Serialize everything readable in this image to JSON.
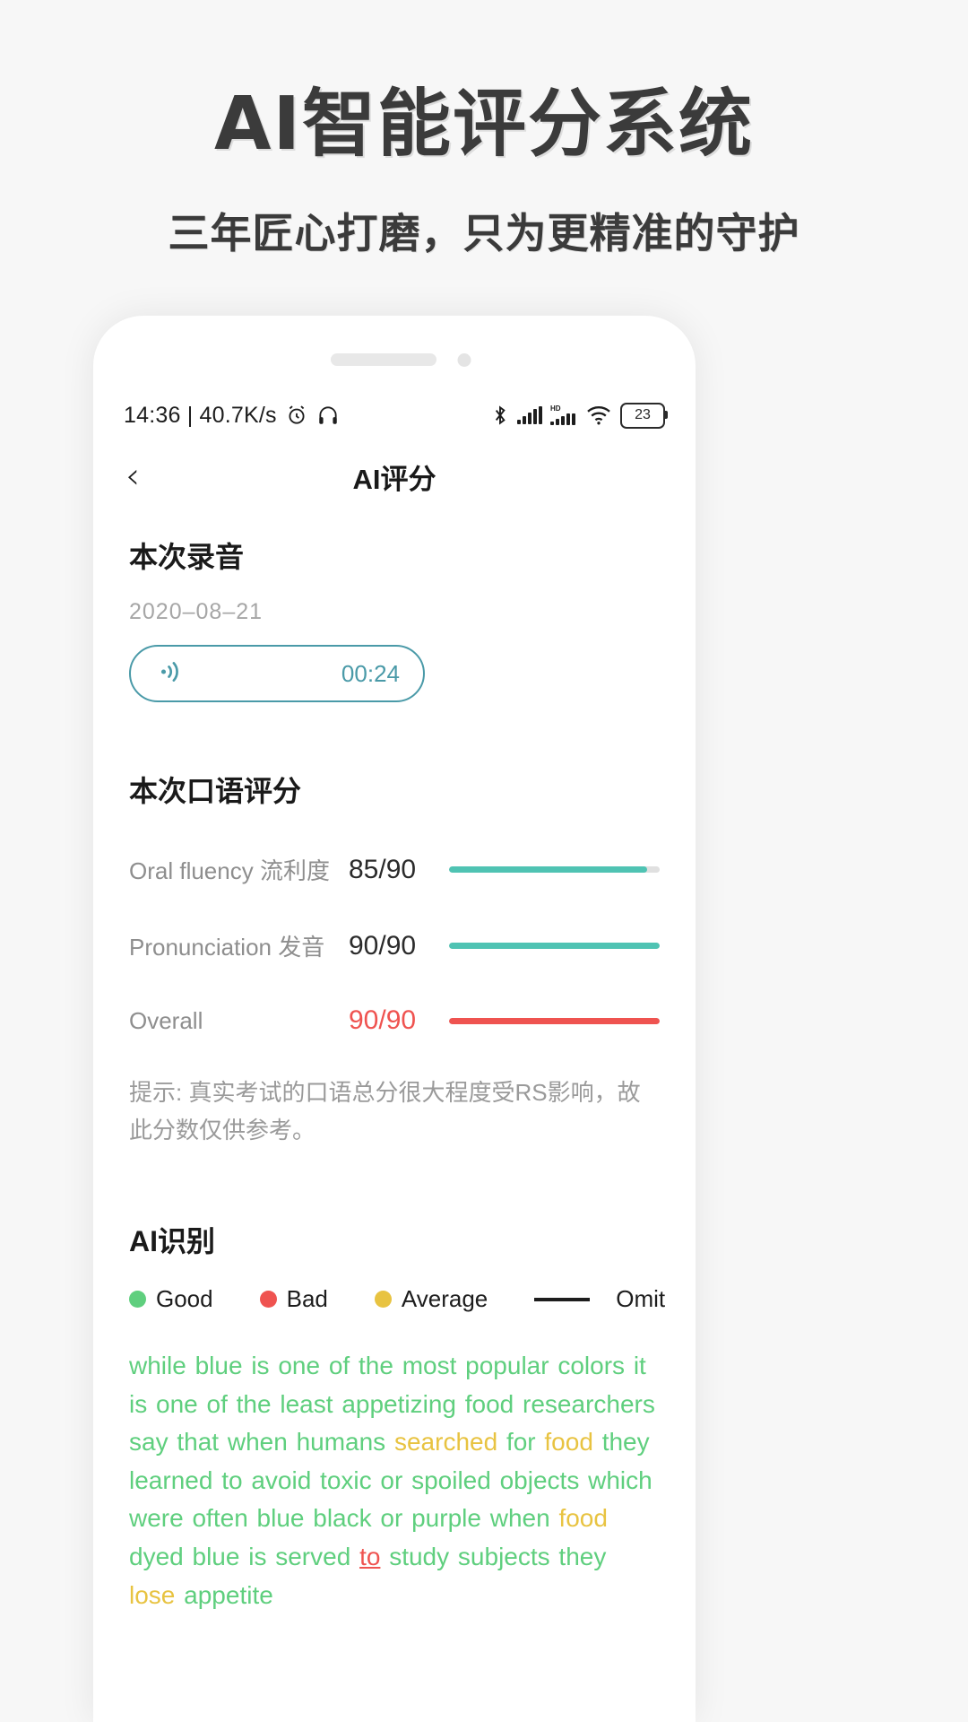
{
  "promo": {
    "title": "AI智能评分系统",
    "subtitle": "三年匠心打磨，只为更精准的守护"
  },
  "statusbar": {
    "time_and_speed": "14:36 | 40.7K/s",
    "alarm_icon": "alarm-clock-icon",
    "headphone_icon": "headphone-icon",
    "bluetooth_icon": "bluetooth-icon",
    "signal_icon": "signal-bars-icon",
    "hd_signal_icon": "hd-signal-bars-icon",
    "wifi_icon": "wifi-icon",
    "battery_level": "23"
  },
  "nav": {
    "back": "‹",
    "title": "AI评分"
  },
  "recording": {
    "section_title": "本次录音",
    "date": "2020–08–21",
    "play_icon": "audio-wave-icon",
    "duration": "00:24"
  },
  "scoring": {
    "section_title": "本次口语评分",
    "rows": [
      {
        "label": "Oral fluency 流利度",
        "value": "85/90",
        "percent": 94,
        "color": "#4fc3b3",
        "accent": "teal"
      },
      {
        "label": "Pronunciation 发音",
        "value": "90/90",
        "percent": 100,
        "color": "#4fc3b3",
        "accent": "teal"
      },
      {
        "label": "Overall",
        "value": "90/90",
        "percent": 100,
        "color": "#ef5350",
        "accent": "red"
      }
    ],
    "tip": "提示: 真实考试的口语总分很大程度受RS影响，故此分数仅供参考。"
  },
  "recognition": {
    "section_title": "AI识别",
    "legend": [
      {
        "label": "Good",
        "color": "#5fcf7e",
        "shape": "dot"
      },
      {
        "label": "Bad",
        "color": "#ef5350",
        "shape": "dot"
      },
      {
        "label": "Average",
        "color": "#e8c341",
        "shape": "dot"
      },
      {
        "label": "Omit",
        "color": "#1d1d1d",
        "shape": "line"
      }
    ],
    "transcript_words": [
      {
        "t": "while",
        "c": "good"
      },
      {
        "t": "blue",
        "c": "good"
      },
      {
        "t": "is",
        "c": "good"
      },
      {
        "t": "one",
        "c": "good"
      },
      {
        "t": "of",
        "c": "good"
      },
      {
        "t": "the",
        "c": "good"
      },
      {
        "t": "most",
        "c": "good"
      },
      {
        "t": "popular",
        "c": "good"
      },
      {
        "t": "colors",
        "c": "good"
      },
      {
        "t": "it",
        "c": "good"
      },
      {
        "t": "is",
        "c": "good"
      },
      {
        "t": "one",
        "c": "good"
      },
      {
        "t": "of",
        "c": "good"
      },
      {
        "t": "the",
        "c": "good"
      },
      {
        "t": "least",
        "c": "good"
      },
      {
        "t": "appetizing",
        "c": "good"
      },
      {
        "t": "food",
        "c": "good"
      },
      {
        "t": "researchers",
        "c": "good"
      },
      {
        "t": "say",
        "c": "good"
      },
      {
        "t": "that",
        "c": "good"
      },
      {
        "t": "when",
        "c": "good"
      },
      {
        "t": "humans",
        "c": "good"
      },
      {
        "t": "searched",
        "c": "avg"
      },
      {
        "t": "for",
        "c": "good"
      },
      {
        "t": "food",
        "c": "avg"
      },
      {
        "t": "they",
        "c": "good"
      },
      {
        "t": "learned",
        "c": "good"
      },
      {
        "t": "to",
        "c": "good"
      },
      {
        "t": "avoid",
        "c": "good"
      },
      {
        "t": "toxic",
        "c": "good"
      },
      {
        "t": "or",
        "c": "good"
      },
      {
        "t": "spoiled",
        "c": "good"
      },
      {
        "t": "objects",
        "c": "good"
      },
      {
        "t": "which",
        "c": "good"
      },
      {
        "t": "were",
        "c": "good"
      },
      {
        "t": "often",
        "c": "good"
      },
      {
        "t": "blue",
        "c": "good"
      },
      {
        "t": "black",
        "c": "good"
      },
      {
        "t": "or",
        "c": "good"
      },
      {
        "t": "purple",
        "c": "good"
      },
      {
        "t": "when",
        "c": "good"
      },
      {
        "t": "food",
        "c": "avg"
      },
      {
        "t": "dyed",
        "c": "good"
      },
      {
        "t": "blue",
        "c": "good"
      },
      {
        "t": "is",
        "c": "good"
      },
      {
        "t": "served",
        "c": "good"
      },
      {
        "t": "to",
        "c": "omit"
      },
      {
        "t": "study",
        "c": "good"
      },
      {
        "t": "subjects",
        "c": "good"
      },
      {
        "t": "they",
        "c": "good"
      },
      {
        "t": "lose",
        "c": "avg"
      },
      {
        "t": "appetite",
        "c": "good"
      }
    ]
  }
}
